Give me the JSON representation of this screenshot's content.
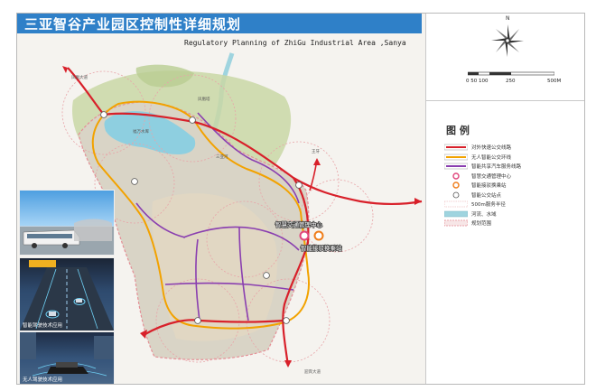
{
  "title": "三亚智谷产业园区控制性详细规划",
  "subtitle": "Regulatory Planning of ZhiGu Industrial Area ,Sanya",
  "compass": {
    "label": "N",
    "icon": "north-arrow-icon"
  },
  "scale_bar": {
    "labels": [
      "0 50 100",
      "250",
      "500M"
    ]
  },
  "legend": {
    "title": "图 例",
    "items": [
      {
        "label": "对外快速公交线路",
        "icon": "red-line-icon",
        "color": "#d8202a"
      },
      {
        "label": "无人智能公交环线",
        "icon": "yellow-line-icon",
        "color": "#f2a200"
      },
      {
        "label": "智能共享汽车服务线路",
        "icon": "purple-line-icon",
        "color": "#8a3fb0"
      },
      {
        "label": "智慧交通管理中心",
        "icon": "pink-circle-icon",
        "color": "#e0457b"
      },
      {
        "label": "智能接驳换乘站",
        "icon": "orange-circle-icon",
        "color": "#ef7d1a"
      },
      {
        "label": "智能公交站点",
        "icon": "white-circle-icon",
        "color": "#ffffff"
      },
      {
        "label": "500m服务半径",
        "icon": "dashed-circle-icon",
        "color": "#e8a4a8"
      },
      {
        "label": "河流、水域",
        "icon": "water-icon",
        "color": "#9fd4df"
      },
      {
        "label": "规划范围",
        "icon": "boundary-icon",
        "color": "#e58f96"
      }
    ]
  },
  "map_labels": {
    "traffic_center": "智慧交通管理中心",
    "transfer_station": "智能接驳换乘站",
    "reservoir": "福万水库",
    "north_area": "凤凰塔",
    "east_area": "王牙",
    "west_road": "凤凰大道",
    "river": "三亚河",
    "south_road": "迎宾大道"
  },
  "photos": [
    {
      "caption": "",
      "icon": "smart-bus-photo"
    },
    {
      "caption": "智能驾驶技术应用",
      "icon": "smart-road-photo"
    },
    {
      "caption": "无人驾驶技术应用",
      "icon": "autonomous-car-photo"
    }
  ]
}
